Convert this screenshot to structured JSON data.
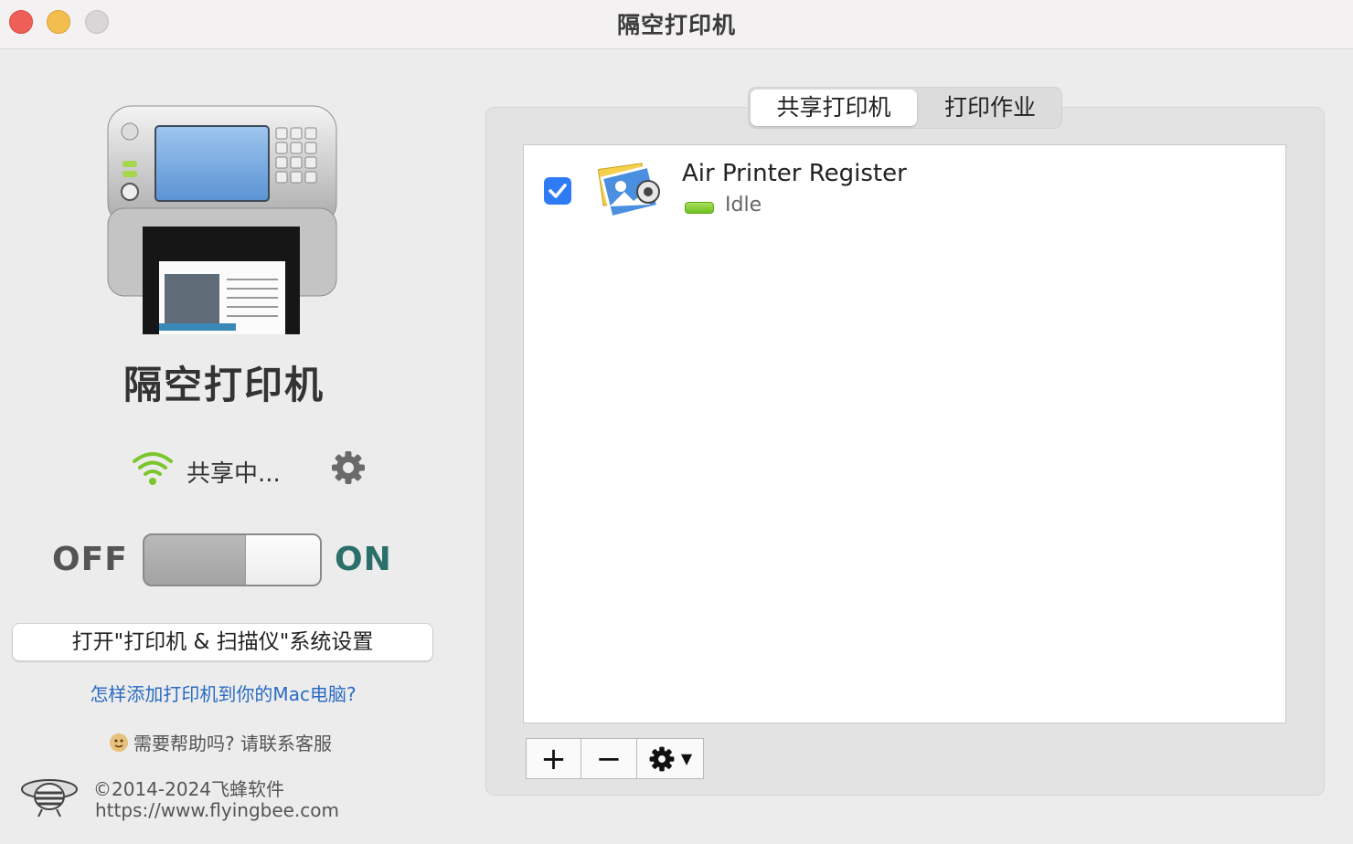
{
  "window": {
    "title": "隔空打印机"
  },
  "sidebar": {
    "app_name": "隔空打印机",
    "sharing_status": "共享中...",
    "toggle": {
      "off_label": "OFF",
      "on_label": "ON",
      "state": "on"
    },
    "open_settings_button": "打开\"打印机 & 扫描仪\"系统设置",
    "help_link": "怎样添加打印机到你的Mac电脑?",
    "support_text": "需要帮助吗? 请联系客服",
    "copyright": "©2014-2024飞蜂软件",
    "website": "https://www.flyingbee.com"
  },
  "tabs": [
    {
      "label": "共享打印机",
      "active": true
    },
    {
      "label": "打印作业",
      "active": false
    }
  ],
  "printers": [
    {
      "name": "Air Printer Register",
      "status": "Idle",
      "checked": true,
      "status_color": "#7cc52c"
    }
  ],
  "list_toolbar": {
    "add": "+",
    "remove": "−",
    "menu_arrow": "▼"
  },
  "colors": {
    "accent": "#2f7bf5",
    "link": "#2a6bc4",
    "on_label": "#2b6f6a"
  }
}
